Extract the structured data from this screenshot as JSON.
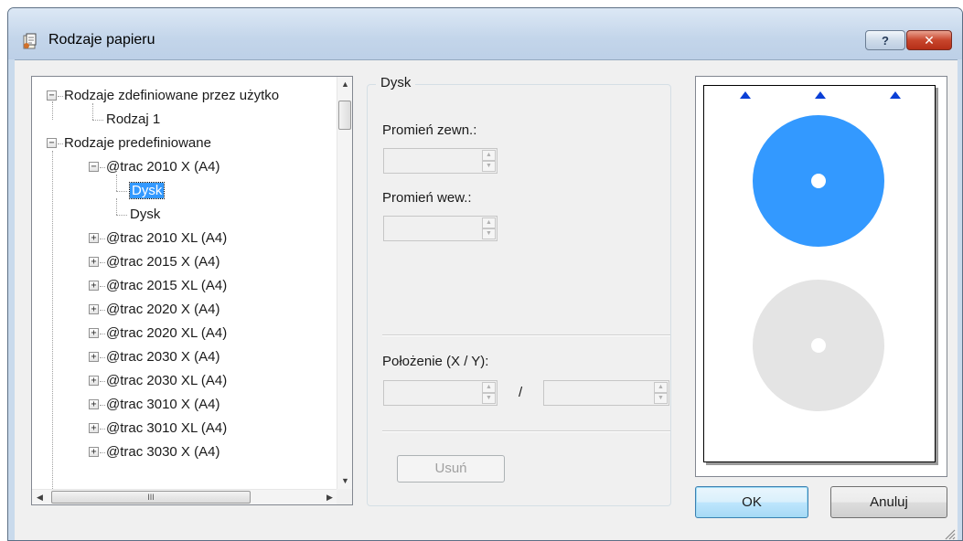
{
  "window": {
    "title": "Rodzaje papieru",
    "help_label": "?",
    "close_label": "✕"
  },
  "tree": {
    "items": [
      {
        "label": "Rodzaje zdefiniowane przez użytko",
        "level": 0,
        "expander": "minus"
      },
      {
        "label": "Rodzaj 1",
        "level": 1,
        "expander": "none"
      },
      {
        "label": "Rodzaje predefiniowane",
        "level": 0,
        "expander": "minus"
      },
      {
        "label": "@trac 2010 X (A4)",
        "level": 1,
        "expander": "minus"
      },
      {
        "label": "Dysk",
        "level": 2,
        "expander": "none",
        "selected": true
      },
      {
        "label": "Dysk",
        "level": 2,
        "expander": "none"
      },
      {
        "label": "@trac 2010 XL (A4)",
        "level": 1,
        "expander": "plus"
      },
      {
        "label": "@trac 2015 X (A4)",
        "level": 1,
        "expander": "plus"
      },
      {
        "label": "@trac 2015 XL (A4)",
        "level": 1,
        "expander": "plus"
      },
      {
        "label": "@trac 2020 X (A4)",
        "level": 1,
        "expander": "plus"
      },
      {
        "label": "@trac 2020 XL (A4)",
        "level": 1,
        "expander": "plus"
      },
      {
        "label": "@trac 2030 X (A4)",
        "level": 1,
        "expander": "plus"
      },
      {
        "label": "@trac 2030 XL (A4)",
        "level": 1,
        "expander": "plus"
      },
      {
        "label": "@trac 3010 X (A4)",
        "level": 1,
        "expander": "plus"
      },
      {
        "label": "@trac 3010 XL (A4)",
        "level": 1,
        "expander": "plus"
      },
      {
        "label": "@trac 3030 X (A4)",
        "level": 1,
        "expander": "plus"
      }
    ],
    "hscroll_grip": "III"
  },
  "disk_group": {
    "title": "Dysk",
    "outer_radius_label": "Promień zewn.:",
    "outer_radius_value": "",
    "inner_radius_label": "Promień wew.:",
    "inner_radius_value": "",
    "position_label": "Położenie (X / Y):",
    "position_x": "",
    "position_y": "",
    "slash": "/",
    "delete_label": "Usuń"
  },
  "buttons": {
    "ok": "OK",
    "cancel": "Anuluj"
  },
  "colors": {
    "active_disc": "#3399ff",
    "inactive_disc": "#e4e4e4",
    "marker": "#0a3fd6",
    "selection": "#3399ff"
  }
}
